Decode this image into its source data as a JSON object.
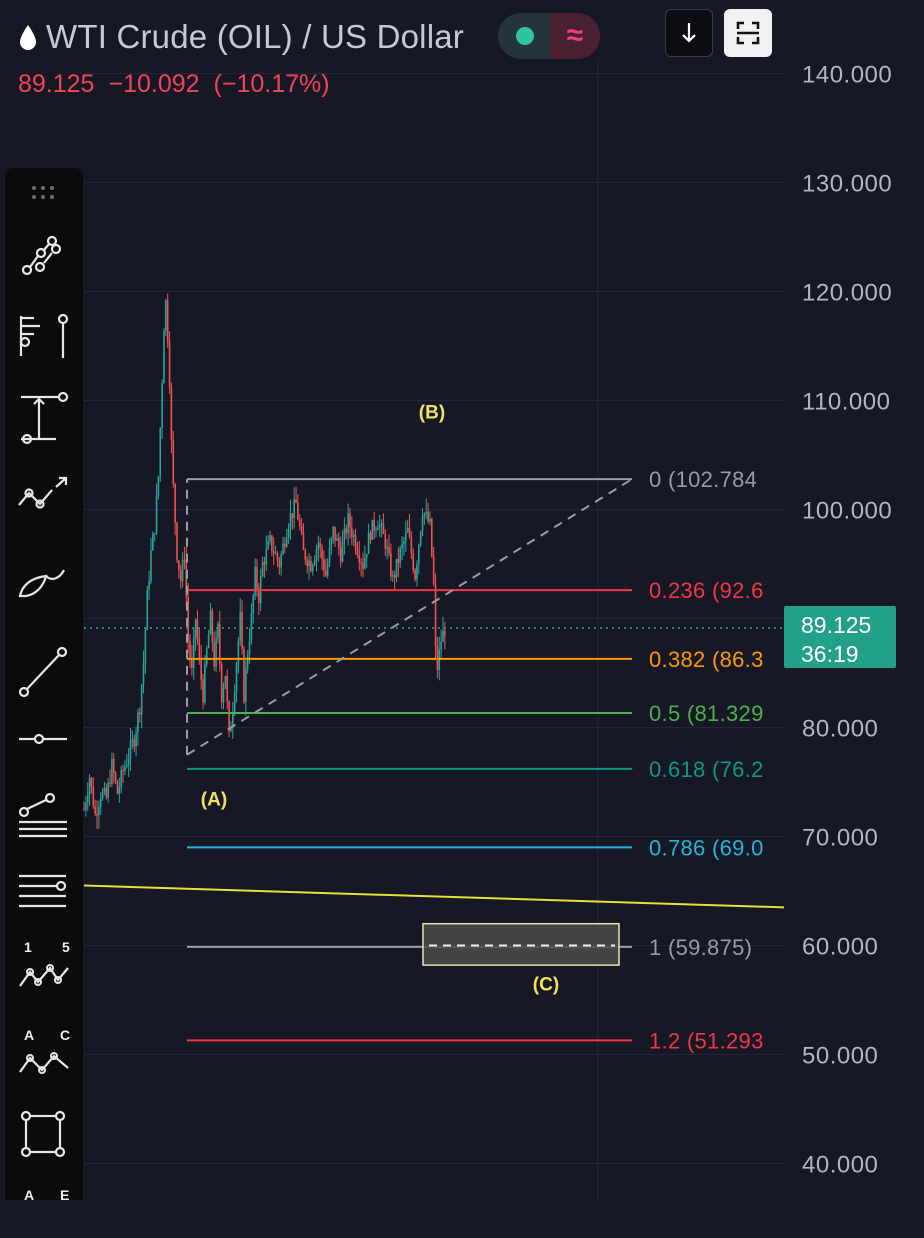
{
  "header": {
    "symbol_icon": "oil-drop-icon",
    "title": "WTI Crude (OIL) / US Dollar",
    "price": "89.125",
    "change": "−10.092",
    "change_pct": "(−10.17%)",
    "status_pill": {
      "left_icon": "green-dot-icon",
      "right_icon": "wave-icon",
      "right_glyph": "≈"
    },
    "buttons": [
      "download-icon",
      "fullscreen-icon"
    ]
  },
  "toolbar": {
    "tools": [
      {
        "icon": "trend-line-icon"
      },
      {
        "icon": "fib-retracement-icon"
      },
      {
        "icon": "measure-icon"
      },
      {
        "icon": "path-icon"
      },
      {
        "icon": "brush-icon"
      },
      {
        "icon": "ray-line-icon"
      },
      {
        "icon": "horizontal-ray-icon"
      },
      {
        "icon": "parallel-channel-icon"
      },
      {
        "icon": "horizontal-lines-icon"
      },
      {
        "icon": "elliott-impulse-icon",
        "labels": [
          "1",
          "5"
        ]
      },
      {
        "icon": "elliott-correction-icon",
        "labels": [
          "A",
          "C"
        ]
      },
      {
        "icon": "rectangle-icon"
      },
      {
        "icon": "abcd-pattern-icon",
        "labels": [
          "A",
          "E"
        ]
      }
    ]
  },
  "colors": {
    "background": "#161825",
    "candle_up": "#26a69a",
    "candle_down": "#ef5350",
    "wave_label": "#f2e35a",
    "trendline": "#e9df3a",
    "current_price_tag": "#22a088"
  },
  "chart_data": {
    "type": "candlestick",
    "symbol": "WTI Crude (OIL) / US Dollar",
    "y_axis": {
      "ticks": [
        "140.000",
        "130.000",
        "120.000",
        "110.000",
        "100.000",
        "80.000",
        "70.000",
        "60.000",
        "50.000",
        "40.000"
      ],
      "range": [
        38,
        144
      ]
    },
    "current_price": {
      "value": "89.125",
      "countdown": "36:19"
    },
    "series_path": [
      [
        0,
        72.5
      ],
      [
        3,
        75.5
      ],
      [
        6,
        72
      ],
      [
        9,
        74
      ],
      [
        12,
        73.5
      ],
      [
        15,
        76.5
      ],
      [
        18,
        74
      ],
      [
        21,
        76
      ],
      [
        24,
        77.5
      ],
      [
        27,
        79
      ],
      [
        30,
        82
      ],
      [
        32,
        86
      ],
      [
        34,
        92
      ],
      [
        36,
        96
      ],
      [
        38,
        98.5
      ],
      [
        40,
        103
      ],
      [
        42,
        112
      ],
      [
        43,
        117
      ],
      [
        44,
        119
      ],
      [
        45,
        116
      ],
      [
        46,
        112
      ],
      [
        47,
        106
      ],
      [
        48,
        102
      ],
      [
        49,
        99
      ],
      [
        50,
        96
      ],
      [
        52,
        93.5
      ],
      [
        54,
        96
      ],
      [
        56,
        88
      ],
      [
        58,
        85
      ],
      [
        60,
        90
      ],
      [
        62,
        86
      ],
      [
        64,
        83
      ],
      [
        66,
        87
      ],
      [
        68,
        90
      ],
      [
        70,
        86
      ],
      [
        72,
        89
      ],
      [
        74,
        83
      ],
      [
        76,
        85
      ],
      [
        78,
        79
      ],
      [
        80,
        82
      ],
      [
        82,
        86
      ],
      [
        84,
        90
      ],
      [
        86,
        83
      ],
      [
        88,
        87
      ],
      [
        90,
        90
      ],
      [
        92,
        94
      ],
      [
        94,
        92
      ],
      [
        96,
        95
      ],
      [
        100,
        97
      ],
      [
        105,
        95
      ],
      [
        110,
        99
      ],
      [
        114,
        100.5
      ],
      [
        118,
        96
      ],
      [
        122,
        95
      ],
      [
        126,
        97
      ],
      [
        130,
        94
      ],
      [
        134,
        98
      ],
      [
        138,
        96
      ],
      [
        142,
        99
      ],
      [
        146,
        97
      ],
      [
        150,
        95
      ],
      [
        154,
        98
      ],
      [
        158,
        99
      ],
      [
        162,
        97
      ],
      [
        166,
        93.5
      ],
      [
        170,
        96
      ],
      [
        174,
        98
      ],
      [
        178,
        94
      ],
      [
        182,
        100
      ],
      [
        186,
        98.5
      ],
      [
        188,
        93
      ],
      [
        189,
        87
      ],
      [
        190,
        85.5
      ],
      [
        192,
        88
      ],
      [
        194,
        89.1
      ]
    ],
    "fib_retracement": {
      "levels": [
        {
          "ratio": "0",
          "value": "102.784",
          "color": "#9a9ca3"
        },
        {
          "ratio": "0.236",
          "value": "92.6",
          "color": "#f23645"
        },
        {
          "ratio": "0.382",
          "value": "86.3",
          "color": "#ff9800"
        },
        {
          "ratio": "0.5",
          "value": "81.329",
          "color": "#4caf50"
        },
        {
          "ratio": "0.618",
          "value": "76.2",
          "color": "#089981"
        },
        {
          "ratio": "0.786",
          "value": "69.0",
          "color": "#1fb6d9"
        },
        {
          "ratio": "1",
          "value": "59.875",
          "color": "#9a9ca3"
        },
        {
          "ratio": "1.2",
          "value": "51.293",
          "color": "#f23645"
        }
      ],
      "label_texts": [
        "0 (102.784",
        "0.236 (92.6",
        "0.382 (86.3",
        "0.5 (81.329",
        "0.618 (76.2",
        "0.786 (69.0",
        "1 (59.875)",
        "1.2 (51.293"
      ]
    },
    "trend_lines": [
      {
        "from": 77.5,
        "to": 102.784,
        "style": "dashed"
      },
      {
        "from": 65.5,
        "to": 63.5,
        "color": "#e9df3a"
      }
    ],
    "target_box": {
      "top": 62.0,
      "bottom": 58.2,
      "midline": 60.0
    },
    "wave_labels": [
      {
        "label": "(A)",
        "value": 73.5
      },
      {
        "label": "(B)",
        "value": 109.0
      },
      {
        "label": "(C)",
        "value": 56.5
      }
    ]
  }
}
